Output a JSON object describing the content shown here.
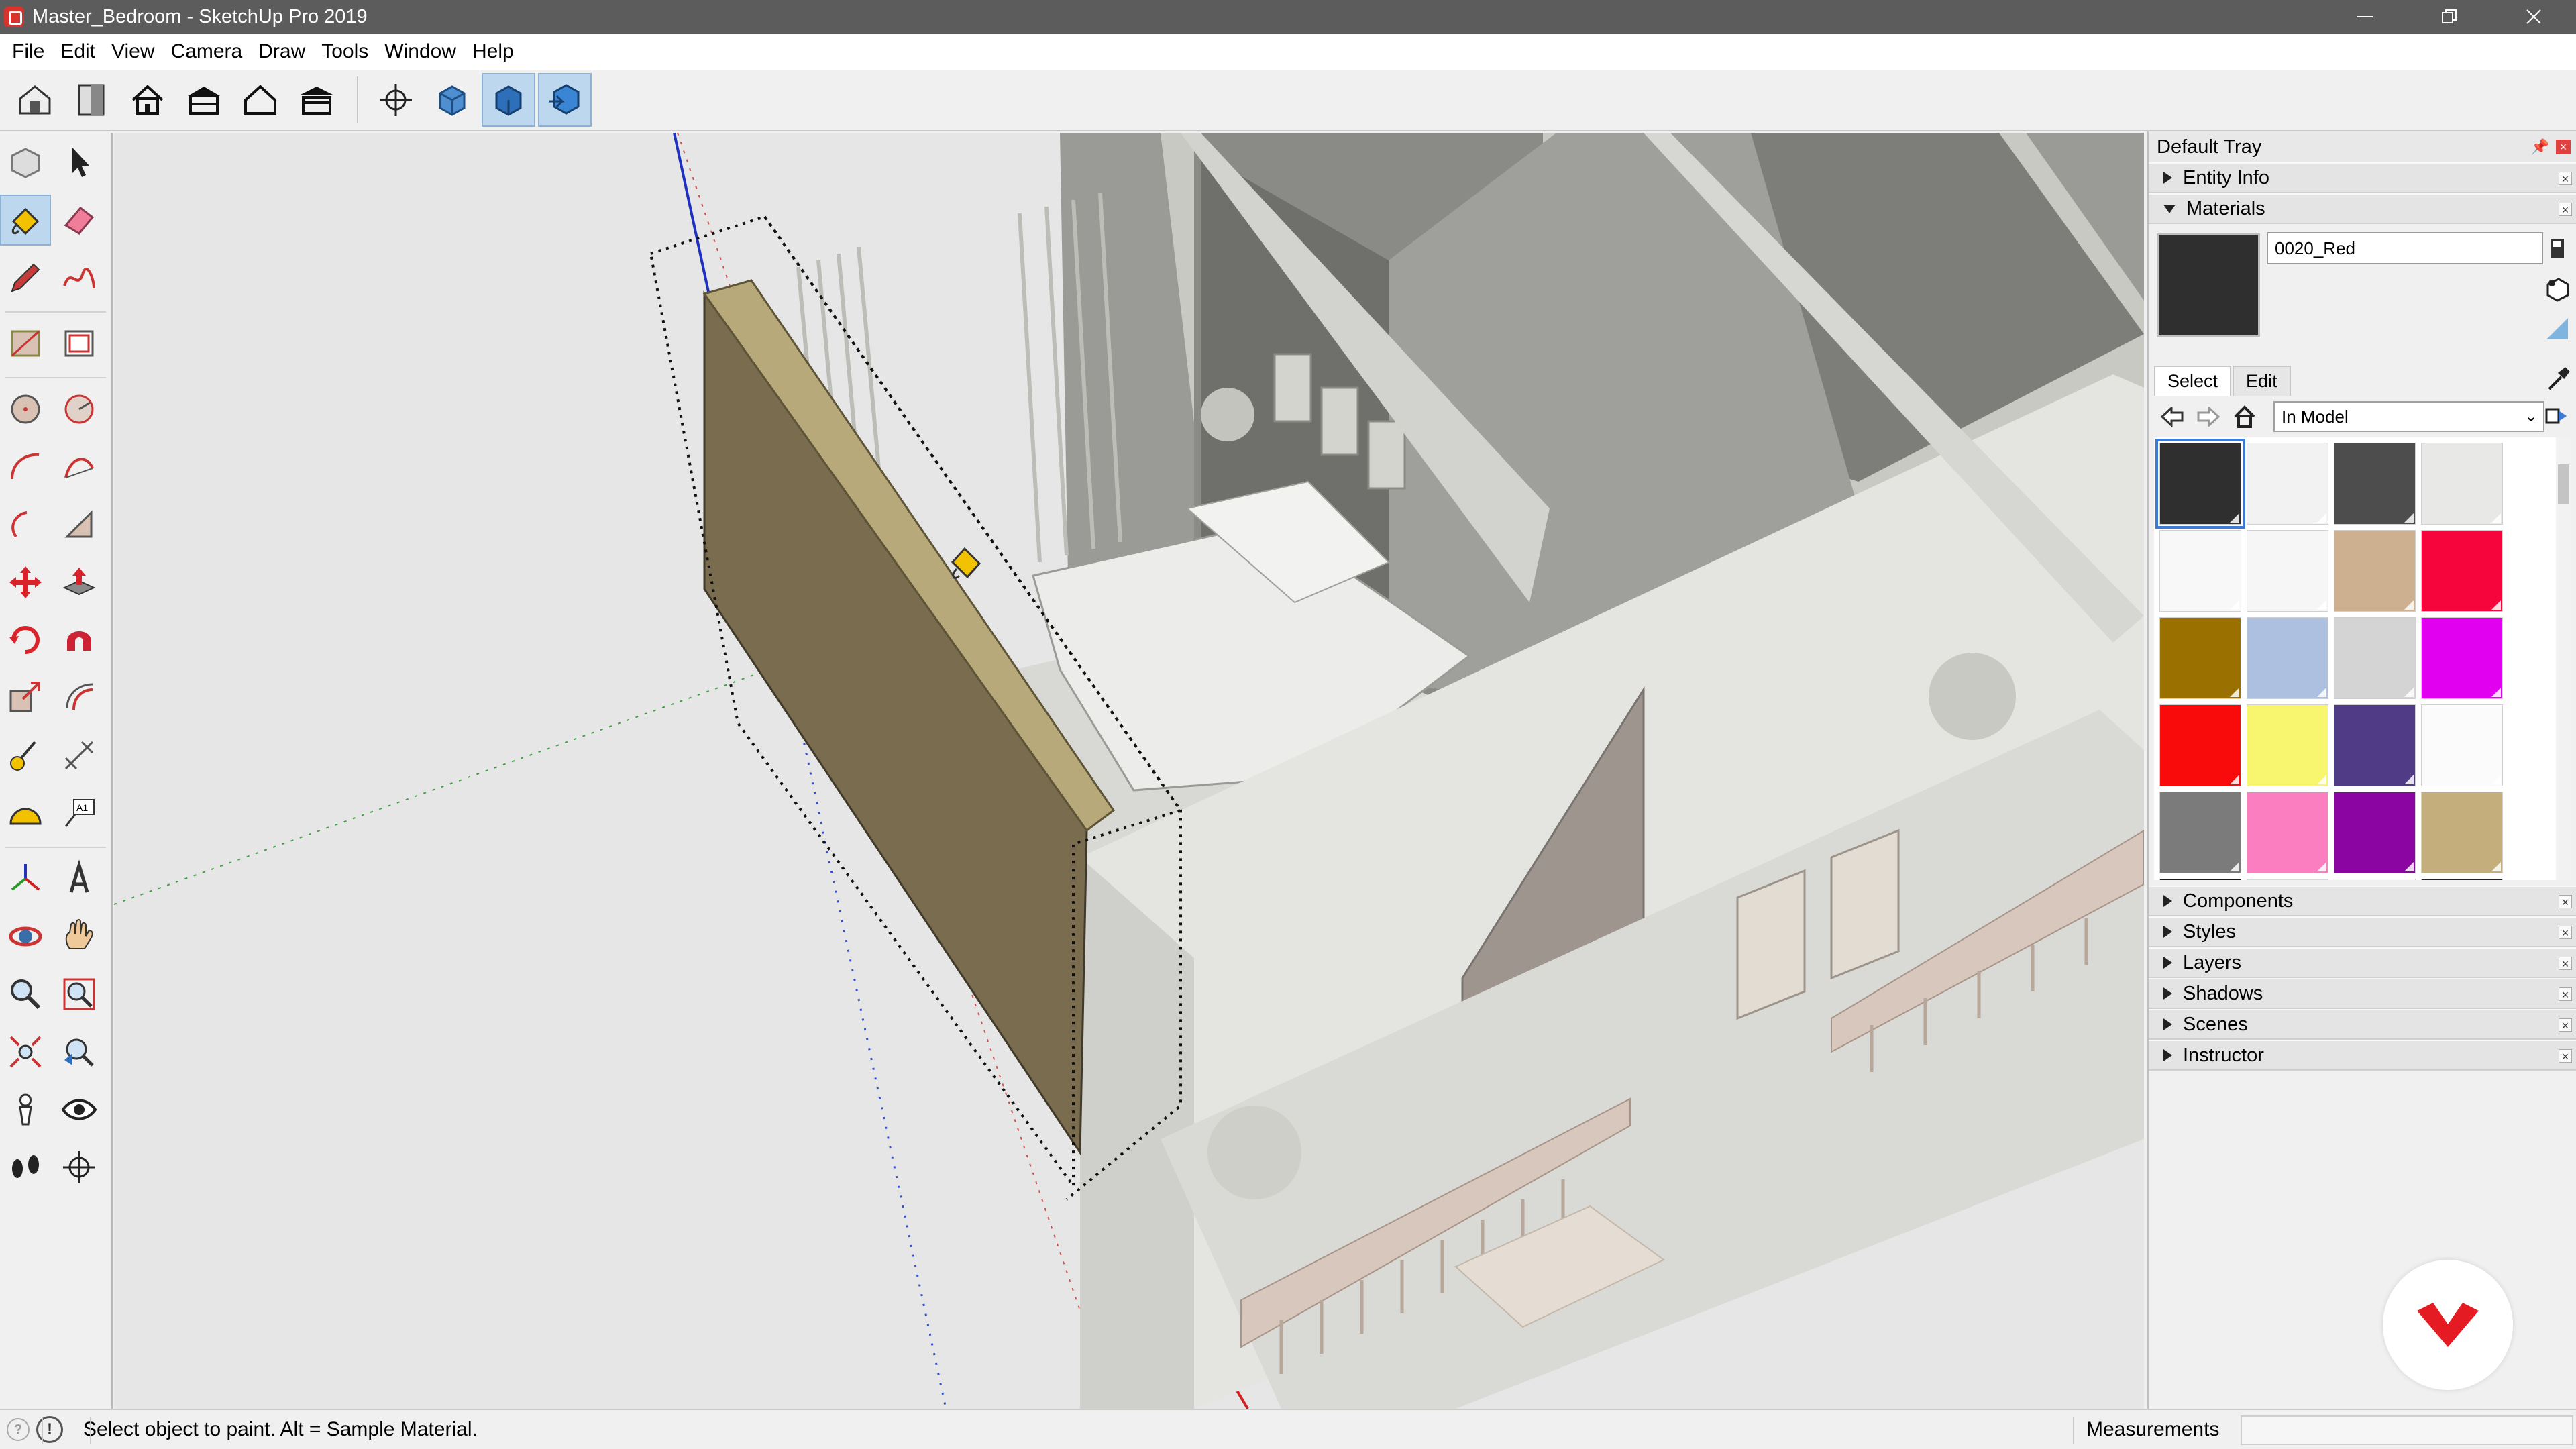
{
  "window": {
    "title": "Master_Bedroom - SketchUp Pro 2019",
    "minimize_icon": "minimize-icon",
    "maximize_icon": "restore-icon",
    "close_icon": "close-icon"
  },
  "menu": {
    "items": [
      "File",
      "Edit",
      "View",
      "Camera",
      "Draw",
      "Tools",
      "Window",
      "Help"
    ]
  },
  "toolbar": {
    "icons": [
      "warehouse-icon",
      "extension-warehouse-icon",
      "house-icon",
      "house-side-icon",
      "house-outline-icon",
      "house-front-icon",
      "section-plane-icon",
      "3d-warehouse-blue-icon",
      "send-to-layout-icon",
      "layout-icon"
    ],
    "active": [
      "send-to-layout-icon",
      "layout-icon"
    ]
  },
  "palette": {
    "icons": [
      "component-icon",
      "select-arrow-icon",
      "paint-bucket-icon",
      "eraser-icon",
      "pencil-icon",
      "freehand-icon",
      "rectangle-icon",
      "rotated-rectangle-icon",
      "circle-icon",
      "polygon-icon",
      "arc-icon",
      "two-point-arc-icon",
      "three-point-arc-icon",
      "pie-icon",
      "move-icon",
      "push-pull-icon",
      "rotate-icon",
      "follow-me-icon",
      "scale-icon",
      "offset-icon",
      "tape-measure-icon",
      "dimension-icon",
      "protractor-icon",
      "text-label-icon",
      "axes-icon",
      "3d-text-icon",
      "orbit-icon",
      "pan-icon",
      "zoom-icon",
      "zoom-window-icon",
      "zoom-extents-icon",
      "previous-view-icon",
      "position-camera-icon",
      "look-around-icon",
      "walk-icon",
      "section-plane-tool-icon"
    ],
    "active": "paint-bucket-icon"
  },
  "tray": {
    "title": "Default Tray",
    "panels_top": [
      "Entity Info"
    ],
    "materials_label": "Materials",
    "panels_bottom": [
      "Components",
      "Styles",
      "Layers",
      "Shadows",
      "Scenes",
      "Instructor"
    ]
  },
  "materials": {
    "current_name": "0020_Red",
    "preview_color": "#2f2f2f",
    "tabs": [
      "Select",
      "Edit"
    ],
    "active_tab": "Select",
    "collection": "In Model",
    "swatches": [
      "#2f2f2f",
      "#f2f2f2",
      "#4d4d4d",
      "#e8e8e6",
      "#f8f8f8",
      "#f6f6f6",
      "#cdb08f",
      "#f5053c",
      "#9a7000",
      "#adc0e0",
      "#d4d4d4",
      "#e200f0",
      "#f90b0b",
      "#f8f66e",
      "#4f3b86",
      "#fbfbfb",
      "#7b7b7b",
      "#fb7ec1",
      "#8b05a2",
      "#c4ae7c"
    ],
    "selected_swatch": 0
  },
  "status": {
    "message": "Select object to paint. Alt = Sample Material.",
    "measurements_label": "Measurements",
    "measurements_value": ""
  },
  "colors": {
    "titlebar": "#5c5c5c",
    "selection_blue": "#3d7ad6",
    "badge_red": "#e41b23",
    "wall_selected": "#7a6c4e",
    "wall_top": "#b8a97a"
  }
}
